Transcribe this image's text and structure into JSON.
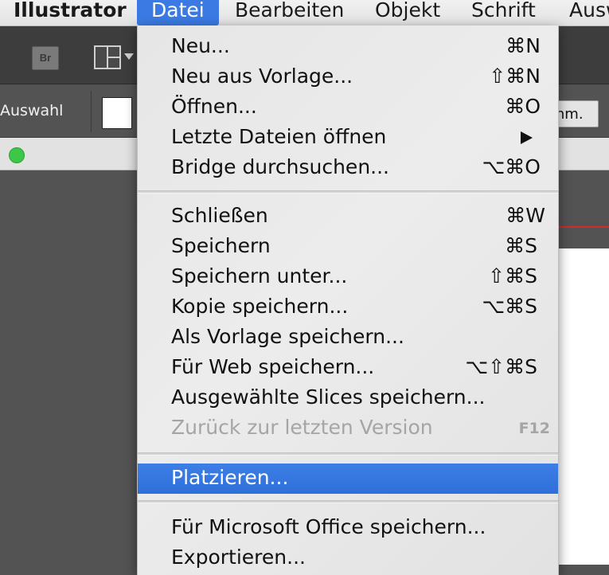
{
  "menubar": {
    "app_name": "Illustrator",
    "items": [
      "Datei",
      "Bearbeiten",
      "Objekt",
      "Schrift",
      "Ausw"
    ],
    "active_item": "Datei"
  },
  "toolbar": {
    "bridge_label": "Br"
  },
  "control_panel": {
    "selection_label": "Auswahl",
    "right_button_label": "chm."
  },
  "file_menu": {
    "group1": [
      {
        "label": "Neu...",
        "shortcut": "⌘N"
      },
      {
        "label": "Neu aus Vorlage...",
        "shortcut": "⇧⌘N"
      },
      {
        "label": "Öffnen...",
        "shortcut": "⌘O"
      },
      {
        "label": "Letzte Dateien öffnen",
        "shortcut": ""
      },
      {
        "label": "Bridge durchsuchen...",
        "shortcut": "⌥⌘O"
      }
    ],
    "group2": [
      {
        "label": "Schließen",
        "shortcut": "⌘W"
      },
      {
        "label": "Speichern",
        "shortcut": "⌘S"
      },
      {
        "label": "Speichern unter...",
        "shortcut": "⇧⌘S"
      },
      {
        "label": "Kopie speichern...",
        "shortcut": "⌥⌘S"
      },
      {
        "label": "Als Vorlage speichern...",
        "shortcut": ""
      },
      {
        "label": "Für Web speichern...",
        "shortcut": "⌥⇧⌘S"
      },
      {
        "label": "Ausgewählte Slices speichern...",
        "shortcut": ""
      },
      {
        "label": "Zurück zur letzten Version",
        "shortcut": "F12"
      }
    ],
    "group3": [
      {
        "label": "Platzieren...",
        "shortcut": ""
      }
    ],
    "group4": [
      {
        "label": "Für Microsoft Office speichern...",
        "shortcut": ""
      },
      {
        "label": "Exportieren...",
        "shortcut": ""
      }
    ]
  },
  "colors": {
    "highlight": "#3a7ae2",
    "traffic_green": "#3ec649"
  }
}
